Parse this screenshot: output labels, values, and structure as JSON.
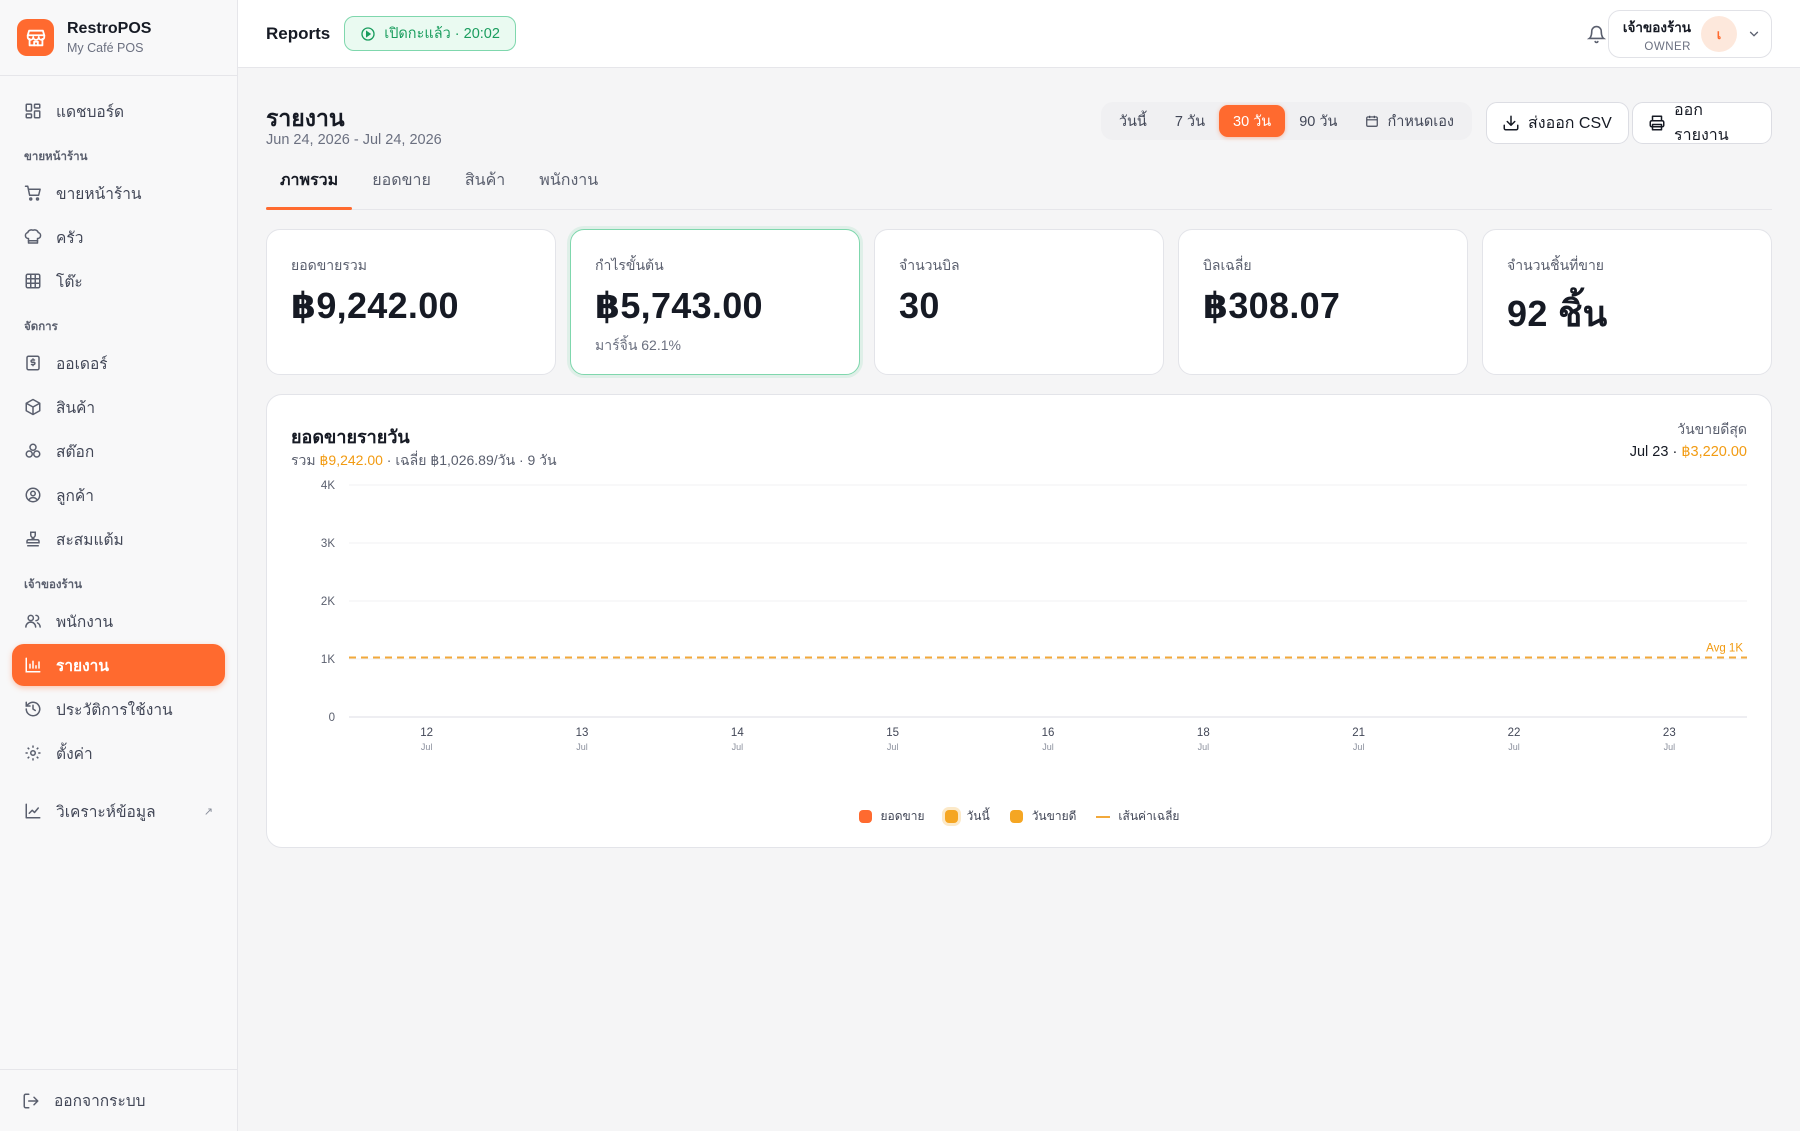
{
  "brand": {
    "name": "RestroPOS",
    "subtitle": "My Café POS"
  },
  "nav": {
    "dashboard": "แดชบอร์ด",
    "section_sales": "ขายหน้าร้าน",
    "pos": "ขายหน้าร้าน",
    "kitchen": "ครัว",
    "tables": "โต๊ะ",
    "section_manage": "จัดการ",
    "orders": "ออเดอร์",
    "products": "สินค้า",
    "stock": "สต๊อก",
    "customers": "ลูกค้า",
    "loyalty": "สะสมแต้ม",
    "section_owner": "เจ้าของร้าน",
    "staff": "พนักงาน",
    "reports": "รายงาน",
    "history": "ประวัติการใช้งาน",
    "settings": "ตั้งค่า",
    "analytics": "วิเคราะห์ข้อมูล",
    "logout": "ออกจากระบบ"
  },
  "topbar": {
    "title": "Reports",
    "shift_status": "เปิดกะแล้ว · 20:02",
    "user_name": "เจ้าของร้าน",
    "user_role": "OWNER",
    "avatar_initial": "เ"
  },
  "page": {
    "title": "รายงาน",
    "date_range": "Jun 24, 2026  -  Jul 24, 2026",
    "ranges": [
      "วันนี้",
      "7 วัน",
      "30 วัน",
      "90 วัน",
      "กำหนดเอง"
    ],
    "active_range": "30 วัน",
    "export_csv": "ส่งออก CSV",
    "print_report": "ออกรายงาน"
  },
  "tabs": [
    "ภาพรวม",
    "ยอดขาย",
    "สินค้า",
    "พนักงาน"
  ],
  "kpis": {
    "total_sales": {
      "label": "ยอดขายรวม",
      "value": "฿9,242.00"
    },
    "gross_profit": {
      "label": "กำไรขั้นต้น",
      "value": "฿5,743.00",
      "sub": "มาร์จิ้น 62.1%"
    },
    "bill_count": {
      "label": "จำนวนบิล",
      "value": "30"
    },
    "avg_bill": {
      "label": "บิลเฉลี่ย",
      "value": "฿308.07"
    },
    "items_sold": {
      "label": "จำนวนชิ้นที่ขาย",
      "value": "92 ชิ้น"
    }
  },
  "daily_chart": {
    "title": "ยอดขายรายวัน",
    "meta_prefix": "รวม ",
    "meta_total": "฿9,242.00",
    "meta_rest": " · เฉลี่ย ฿1,026.89/วัน · 9 วัน",
    "best_label": "วันขายดีสุด",
    "best_day": "Jul 23 · ",
    "best_amount": "฿3,220.00",
    "legend": {
      "sales": "ยอดขาย",
      "today": "วันนี้",
      "best": "วันขายดี",
      "avg": "เส้นค่าเฉลี่ย"
    },
    "colors": {
      "sales": "#ff6a2f",
      "today": "#f5a623",
      "best": "#f5a623",
      "avg": "#f2a93b"
    }
  },
  "chart_data": {
    "type": "bar",
    "categories": [
      "12",
      "13",
      "14",
      "15",
      "16",
      "18",
      "21",
      "22",
      "23"
    ],
    "category_sub": "Jul",
    "values": [
      0,
      0,
      0,
      0,
      0,
      0,
      0,
      0,
      0
    ],
    "y_ticks": [
      "0",
      "1K",
      "2K",
      "3K",
      "4K"
    ],
    "ylim": [
      0,
      4000
    ],
    "average": 1026.89,
    "average_label": "Avg 1K",
    "grid": true,
    "legend_position": "bottom"
  }
}
